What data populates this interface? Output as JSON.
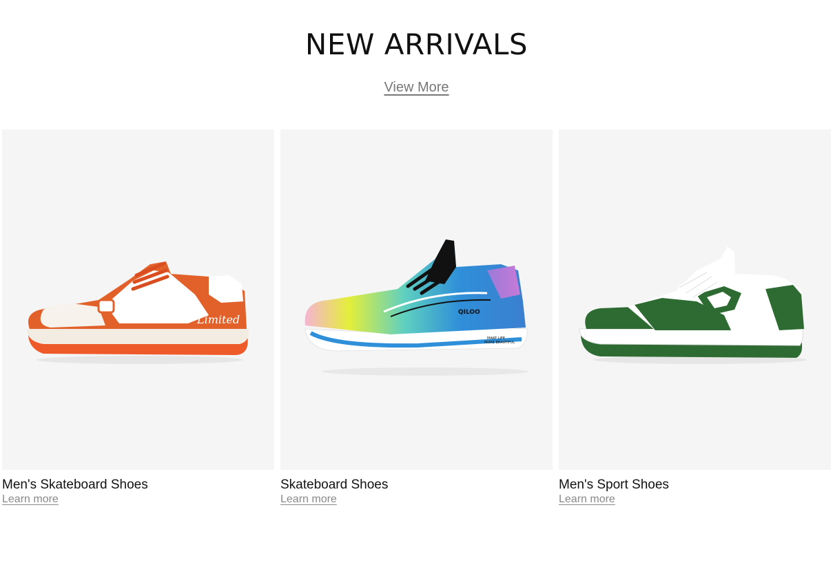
{
  "section": {
    "title": "NEW ARRIVALS",
    "view_more_label": "View More"
  },
  "products": [
    {
      "name": "Men's Skateboard Shoes",
      "link_label": "Learn more",
      "image_icon": "orange-white-sneaker-icon",
      "accent_color": "#e2612a"
    },
    {
      "name": "Skateboard Shoes",
      "link_label": "Learn more",
      "image_icon": "gradient-running-shoe-icon",
      "accent_color": "#2f8fd8"
    },
    {
      "name": "Men's Sport Shoes",
      "link_label": "Learn more",
      "image_icon": "green-white-sneaker-icon",
      "accent_color": "#2e6b33"
    }
  ]
}
